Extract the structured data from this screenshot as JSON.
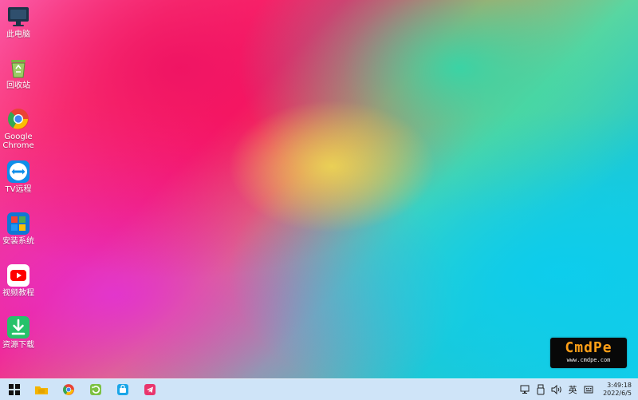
{
  "desktop": {
    "icons": [
      {
        "label": "此电脑",
        "icon": "computer-icon"
      },
      {
        "label": "回收站",
        "icon": "recycle-bin-icon"
      },
      {
        "label": "Google\nChrome",
        "icon": "chrome-icon"
      },
      {
        "label": "TV远程",
        "icon": "teamviewer-icon"
      },
      {
        "label": "安装系统",
        "icon": "install-system-icon"
      },
      {
        "label": "视频教程",
        "icon": "video-tutorial-icon"
      },
      {
        "label": "资源下载",
        "icon": "download-icon"
      }
    ]
  },
  "watermark": {
    "brand": "CmdPe",
    "url": "www.cmdpe.com"
  },
  "taskbar": {
    "pinned": [
      {
        "icon": "start-menu-icon"
      },
      {
        "icon": "file-explorer-icon"
      },
      {
        "icon": "chrome-icon"
      },
      {
        "icon": "refresh-app-icon"
      },
      {
        "icon": "store-icon"
      },
      {
        "icon": "telegram-icon"
      }
    ],
    "tray": {
      "network": "network-icon",
      "usb": "usb-icon",
      "volume": "volume-icon",
      "ime": "英",
      "keyboard": "keyboard-icon"
    },
    "clock": {
      "time": "3:49:18",
      "date": "2022/6/5"
    }
  },
  "colors": {
    "taskbar_bg": "#cfe4f8",
    "watermark_bg": "#080808",
    "watermark_brand": "#ff9f17"
  }
}
